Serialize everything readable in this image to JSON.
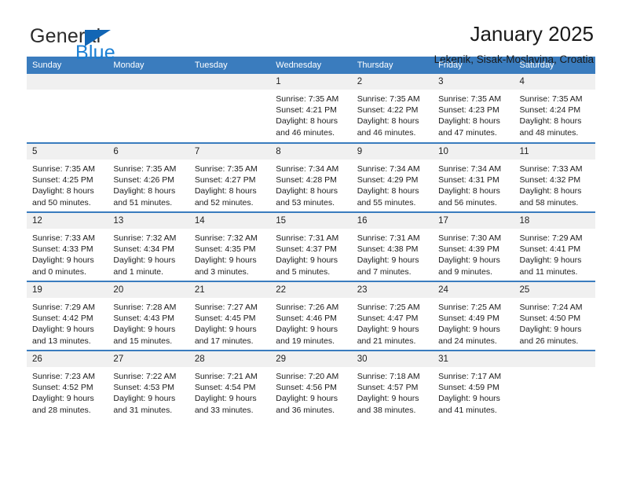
{
  "brand": {
    "name_part1": "General",
    "name_part2": "Blue",
    "flag_icon": "triangle-flag-icon",
    "accent_color": "#1a7fd4"
  },
  "header": {
    "title": "January 2025",
    "subtitle": "Lekenik, Sisak-Moslavina, Croatia"
  },
  "theme": {
    "header_row_bg": "#3a7cbe",
    "daynum_bg": "#f0f0f0",
    "row_divider": "#3a7cbe"
  },
  "weekday_headers": [
    "Sunday",
    "Monday",
    "Tuesday",
    "Wednesday",
    "Thursday",
    "Friday",
    "Saturday"
  ],
  "weeks": [
    [
      {
        "day": "",
        "blank": true,
        "sunrise": "",
        "sunset": "",
        "daylight_1": "",
        "daylight_2": ""
      },
      {
        "day": "",
        "blank": true,
        "sunrise": "",
        "sunset": "",
        "daylight_1": "",
        "daylight_2": ""
      },
      {
        "day": "",
        "blank": true,
        "sunrise": "",
        "sunset": "",
        "daylight_1": "",
        "daylight_2": ""
      },
      {
        "day": "1",
        "blank": false,
        "sunrise": "Sunrise: 7:35 AM",
        "sunset": "Sunset: 4:21 PM",
        "daylight_1": "Daylight: 8 hours",
        "daylight_2": "and 46 minutes."
      },
      {
        "day": "2",
        "blank": false,
        "sunrise": "Sunrise: 7:35 AM",
        "sunset": "Sunset: 4:22 PM",
        "daylight_1": "Daylight: 8 hours",
        "daylight_2": "and 46 minutes."
      },
      {
        "day": "3",
        "blank": false,
        "sunrise": "Sunrise: 7:35 AM",
        "sunset": "Sunset: 4:23 PM",
        "daylight_1": "Daylight: 8 hours",
        "daylight_2": "and 47 minutes."
      },
      {
        "day": "4",
        "blank": false,
        "sunrise": "Sunrise: 7:35 AM",
        "sunset": "Sunset: 4:24 PM",
        "daylight_1": "Daylight: 8 hours",
        "daylight_2": "and 48 minutes."
      }
    ],
    [
      {
        "day": "5",
        "blank": false,
        "sunrise": "Sunrise: 7:35 AM",
        "sunset": "Sunset: 4:25 PM",
        "daylight_1": "Daylight: 8 hours",
        "daylight_2": "and 50 minutes."
      },
      {
        "day": "6",
        "blank": false,
        "sunrise": "Sunrise: 7:35 AM",
        "sunset": "Sunset: 4:26 PM",
        "daylight_1": "Daylight: 8 hours",
        "daylight_2": "and 51 minutes."
      },
      {
        "day": "7",
        "blank": false,
        "sunrise": "Sunrise: 7:35 AM",
        "sunset": "Sunset: 4:27 PM",
        "daylight_1": "Daylight: 8 hours",
        "daylight_2": "and 52 minutes."
      },
      {
        "day": "8",
        "blank": false,
        "sunrise": "Sunrise: 7:34 AM",
        "sunset": "Sunset: 4:28 PM",
        "daylight_1": "Daylight: 8 hours",
        "daylight_2": "and 53 minutes."
      },
      {
        "day": "9",
        "blank": false,
        "sunrise": "Sunrise: 7:34 AM",
        "sunset": "Sunset: 4:29 PM",
        "daylight_1": "Daylight: 8 hours",
        "daylight_2": "and 55 minutes."
      },
      {
        "day": "10",
        "blank": false,
        "sunrise": "Sunrise: 7:34 AM",
        "sunset": "Sunset: 4:31 PM",
        "daylight_1": "Daylight: 8 hours",
        "daylight_2": "and 56 minutes."
      },
      {
        "day": "11",
        "blank": false,
        "sunrise": "Sunrise: 7:33 AM",
        "sunset": "Sunset: 4:32 PM",
        "daylight_1": "Daylight: 8 hours",
        "daylight_2": "and 58 minutes."
      }
    ],
    [
      {
        "day": "12",
        "blank": false,
        "sunrise": "Sunrise: 7:33 AM",
        "sunset": "Sunset: 4:33 PM",
        "daylight_1": "Daylight: 9 hours",
        "daylight_2": "and 0 minutes."
      },
      {
        "day": "13",
        "blank": false,
        "sunrise": "Sunrise: 7:32 AM",
        "sunset": "Sunset: 4:34 PM",
        "daylight_1": "Daylight: 9 hours",
        "daylight_2": "and 1 minute."
      },
      {
        "day": "14",
        "blank": false,
        "sunrise": "Sunrise: 7:32 AM",
        "sunset": "Sunset: 4:35 PM",
        "daylight_1": "Daylight: 9 hours",
        "daylight_2": "and 3 minutes."
      },
      {
        "day": "15",
        "blank": false,
        "sunrise": "Sunrise: 7:31 AM",
        "sunset": "Sunset: 4:37 PM",
        "daylight_1": "Daylight: 9 hours",
        "daylight_2": "and 5 minutes."
      },
      {
        "day": "16",
        "blank": false,
        "sunrise": "Sunrise: 7:31 AM",
        "sunset": "Sunset: 4:38 PM",
        "daylight_1": "Daylight: 9 hours",
        "daylight_2": "and 7 minutes."
      },
      {
        "day": "17",
        "blank": false,
        "sunrise": "Sunrise: 7:30 AM",
        "sunset": "Sunset: 4:39 PM",
        "daylight_1": "Daylight: 9 hours",
        "daylight_2": "and 9 minutes."
      },
      {
        "day": "18",
        "blank": false,
        "sunrise": "Sunrise: 7:29 AM",
        "sunset": "Sunset: 4:41 PM",
        "daylight_1": "Daylight: 9 hours",
        "daylight_2": "and 11 minutes."
      }
    ],
    [
      {
        "day": "19",
        "blank": false,
        "sunrise": "Sunrise: 7:29 AM",
        "sunset": "Sunset: 4:42 PM",
        "daylight_1": "Daylight: 9 hours",
        "daylight_2": "and 13 minutes."
      },
      {
        "day": "20",
        "blank": false,
        "sunrise": "Sunrise: 7:28 AM",
        "sunset": "Sunset: 4:43 PM",
        "daylight_1": "Daylight: 9 hours",
        "daylight_2": "and 15 minutes."
      },
      {
        "day": "21",
        "blank": false,
        "sunrise": "Sunrise: 7:27 AM",
        "sunset": "Sunset: 4:45 PM",
        "daylight_1": "Daylight: 9 hours",
        "daylight_2": "and 17 minutes."
      },
      {
        "day": "22",
        "blank": false,
        "sunrise": "Sunrise: 7:26 AM",
        "sunset": "Sunset: 4:46 PM",
        "daylight_1": "Daylight: 9 hours",
        "daylight_2": "and 19 minutes."
      },
      {
        "day": "23",
        "blank": false,
        "sunrise": "Sunrise: 7:25 AM",
        "sunset": "Sunset: 4:47 PM",
        "daylight_1": "Daylight: 9 hours",
        "daylight_2": "and 21 minutes."
      },
      {
        "day": "24",
        "blank": false,
        "sunrise": "Sunrise: 7:25 AM",
        "sunset": "Sunset: 4:49 PM",
        "daylight_1": "Daylight: 9 hours",
        "daylight_2": "and 24 minutes."
      },
      {
        "day": "25",
        "blank": false,
        "sunrise": "Sunrise: 7:24 AM",
        "sunset": "Sunset: 4:50 PM",
        "daylight_1": "Daylight: 9 hours",
        "daylight_2": "and 26 minutes."
      }
    ],
    [
      {
        "day": "26",
        "blank": false,
        "sunrise": "Sunrise: 7:23 AM",
        "sunset": "Sunset: 4:52 PM",
        "daylight_1": "Daylight: 9 hours",
        "daylight_2": "and 28 minutes."
      },
      {
        "day": "27",
        "blank": false,
        "sunrise": "Sunrise: 7:22 AM",
        "sunset": "Sunset: 4:53 PM",
        "daylight_1": "Daylight: 9 hours",
        "daylight_2": "and 31 minutes."
      },
      {
        "day": "28",
        "blank": false,
        "sunrise": "Sunrise: 7:21 AM",
        "sunset": "Sunset: 4:54 PM",
        "daylight_1": "Daylight: 9 hours",
        "daylight_2": "and 33 minutes."
      },
      {
        "day": "29",
        "blank": false,
        "sunrise": "Sunrise: 7:20 AM",
        "sunset": "Sunset: 4:56 PM",
        "daylight_1": "Daylight: 9 hours",
        "daylight_2": "and 36 minutes."
      },
      {
        "day": "30",
        "blank": false,
        "sunrise": "Sunrise: 7:18 AM",
        "sunset": "Sunset: 4:57 PM",
        "daylight_1": "Daylight: 9 hours",
        "daylight_2": "and 38 minutes."
      },
      {
        "day": "31",
        "blank": false,
        "sunrise": "Sunrise: 7:17 AM",
        "sunset": "Sunset: 4:59 PM",
        "daylight_1": "Daylight: 9 hours",
        "daylight_2": "and 41 minutes."
      },
      {
        "day": "",
        "blank": true,
        "sunrise": "",
        "sunset": "",
        "daylight_1": "",
        "daylight_2": ""
      }
    ]
  ]
}
